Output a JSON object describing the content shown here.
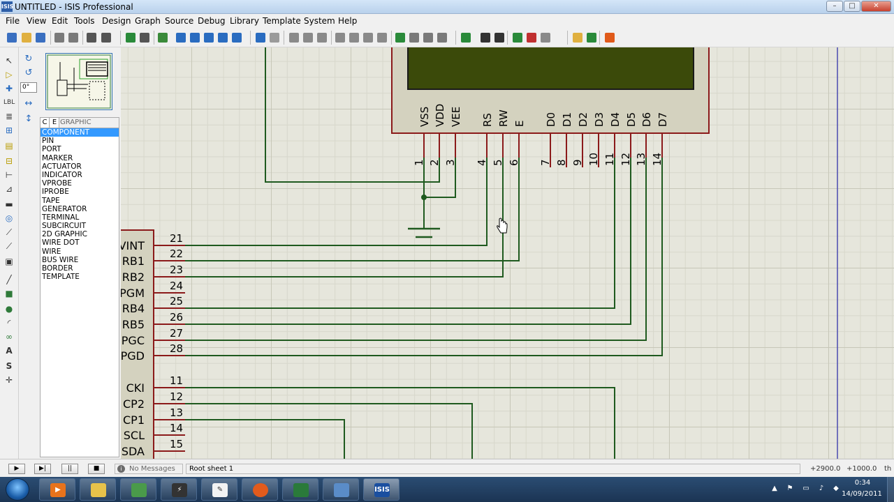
{
  "window": {
    "icon_text": "ISIS",
    "title": "UNTITLED - ISIS Professional",
    "min_label": "–",
    "max_label": "□",
    "close_label": "✕"
  },
  "menu": [
    "File",
    "View",
    "Edit",
    "Tools",
    "Design",
    "Graph",
    "Source",
    "Debug",
    "Library",
    "Template",
    "System",
    "Help"
  ],
  "toolbar_icons": [
    "new-icon",
    "open-icon",
    "save-icon",
    "import-icon",
    "export-icon",
    "print-icon",
    "print-area-icon",
    "refresh-icon",
    "grid-icon",
    "origin-icon",
    "pan-icon",
    "zoom-in-icon",
    "zoom-out-icon",
    "zoom-all-icon",
    "zoom-area-icon",
    "undo-icon",
    "redo-icon",
    "cut-icon",
    "copy-icon",
    "paste-icon",
    "block-copy-icon",
    "block-move-icon",
    "block-rotate-icon",
    "block-delete-icon",
    "pick-device-icon",
    "make-device-icon",
    "packaging-icon",
    "decompose-icon",
    "wire-autorouter-icon",
    "search-tag-icon",
    "property-assign-icon",
    "new-sheet-icon",
    "remove-sheet-icon",
    "goto-sheet-icon",
    "bom-icon",
    "erc-icon",
    "ares-icon"
  ],
  "selector": {
    "angle": "0°",
    "tab_c": "C",
    "tab_e": "E",
    "tab_title": "GRAPHIC STYLES",
    "modes": [
      "COMPONENT",
      "PIN",
      "PORT",
      "MARKER",
      "ACTUATOR",
      "INDICATOR",
      "VPROBE",
      "IPROBE",
      "TAPE",
      "GENERATOR",
      "TERMINAL",
      "SUBCIRCUIT",
      "2D GRAPHIC",
      "WIRE DOT",
      "WIRE",
      "BUS WIRE",
      "BORDER",
      "TEMPLATE"
    ],
    "selected": "COMPONENT"
  },
  "lcd": {
    "pin_names": [
      "VSS",
      "VDD",
      "VEE",
      "RS",
      "RW",
      "E",
      "D0",
      "D1",
      "D2",
      "D3",
      "D4",
      "D5",
      "D6",
      "D7"
    ],
    "pin_numbers": [
      "1",
      "2",
      "3",
      "4",
      "5",
      "6",
      "7",
      "8",
      "9",
      "10",
      "11",
      "12",
      "13",
      "14"
    ]
  },
  "mcu": {
    "pins": [
      {
        "name": "VINT",
        "num": "21"
      },
      {
        "name": "RB1",
        "num": "22"
      },
      {
        "name": "RB2",
        "num": "23"
      },
      {
        "name": "PGM",
        "num": "24"
      },
      {
        "name": "RB4",
        "num": "25"
      },
      {
        "name": "RB5",
        "num": "26"
      },
      {
        "name": "PGC",
        "num": "27"
      },
      {
        "name": "PGD",
        "num": "28"
      },
      {
        "name": "CKI",
        "num": "11"
      },
      {
        "name": "CP2",
        "num": "12"
      },
      {
        "name": "CP1",
        "num": "13"
      },
      {
        "name": "SCL",
        "num": "14"
      },
      {
        "name": "SDA",
        "num": "15"
      }
    ]
  },
  "status": {
    "play": "▶",
    "step": "▶|",
    "pause": "||",
    "stop": "■",
    "message_icon": "i",
    "messages": "No Messages",
    "sheet": "Root sheet 1",
    "coord_x": "+2900.0",
    "coord_y": "+1000.0",
    "unit": "th"
  },
  "taskbar": {
    "apps": [
      "windows-explorer",
      "media-player",
      "file-explorer",
      "network-app",
      "pencil-app",
      "word-pad",
      "firefox",
      "clock-app",
      "dual-screen",
      "isis"
    ],
    "isis_label": "ISIS",
    "time": "0:34",
    "date": "14/09/2011"
  },
  "colors": {
    "wire": "#1f5a1f",
    "component": "#8b1a1a",
    "body": "#d4d2bf",
    "lcd_screen": "#3b4a0a"
  }
}
